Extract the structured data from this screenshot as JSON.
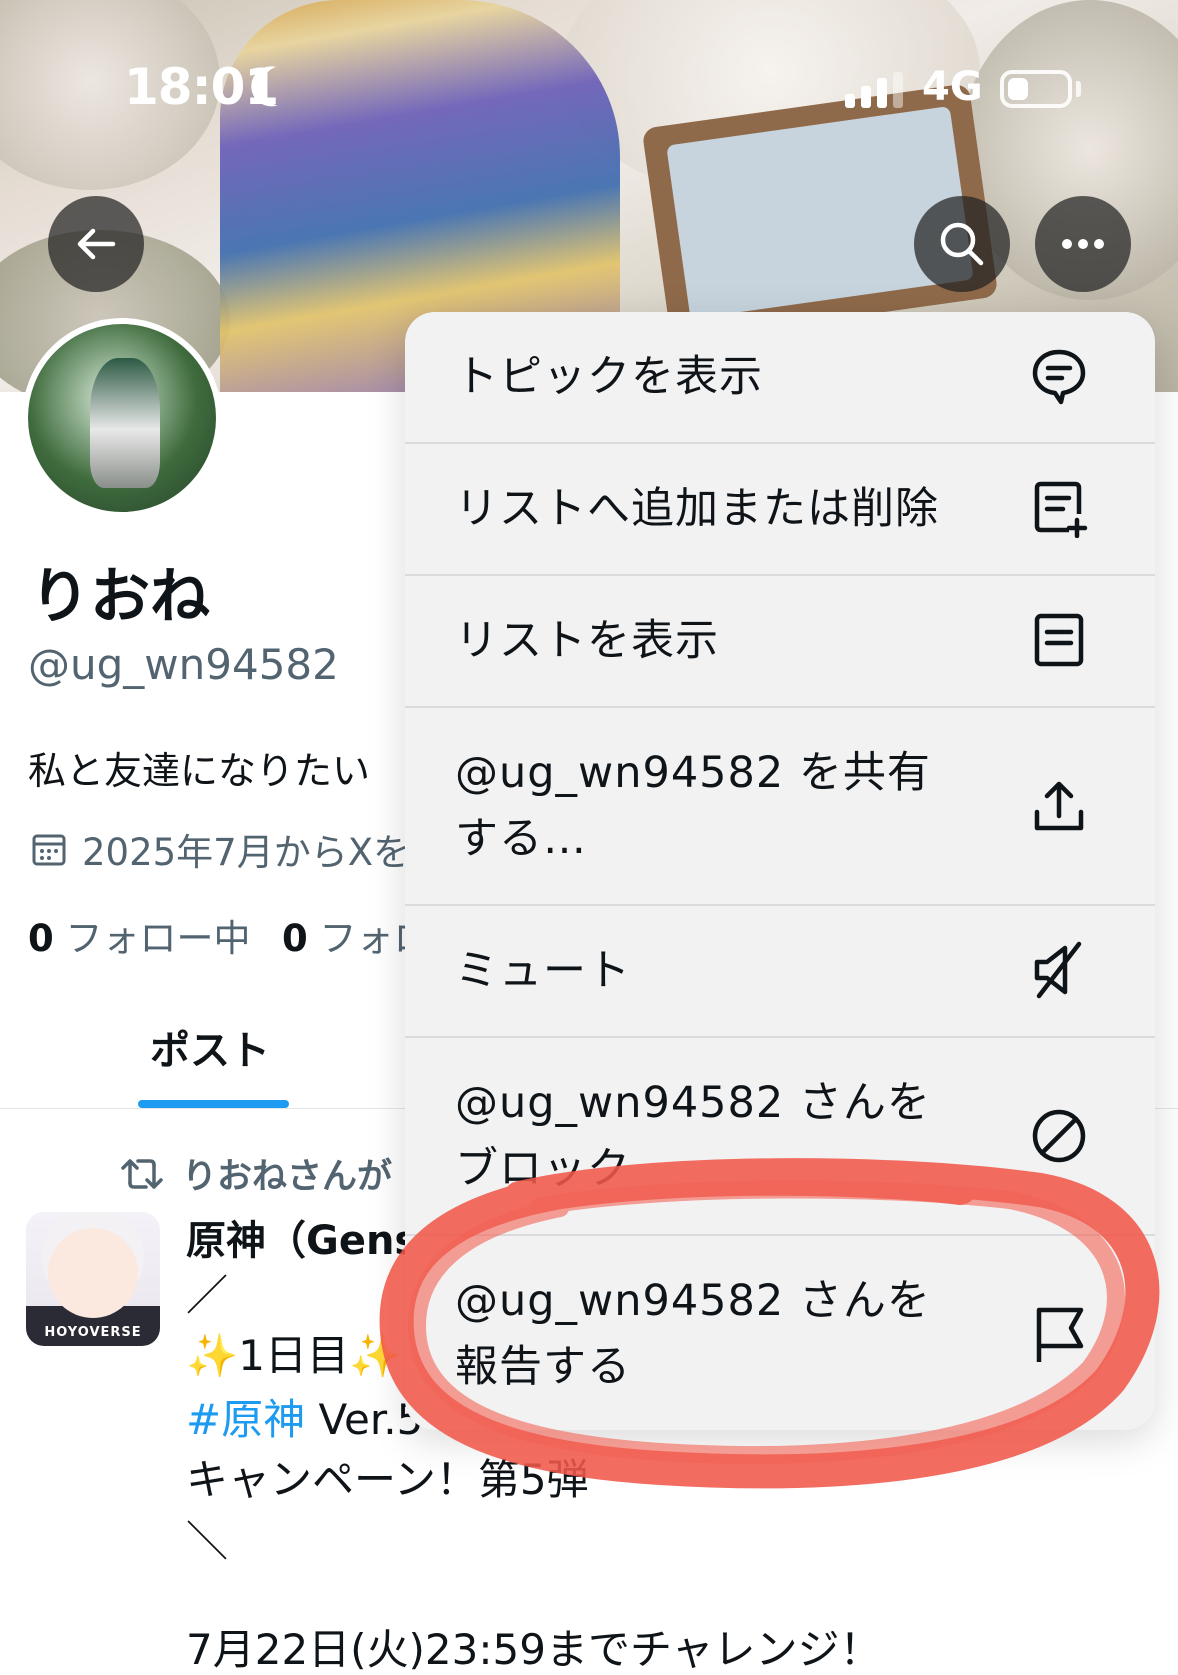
{
  "status_bar": {
    "time": "18:01",
    "network": "4G"
  },
  "header": {
    "back_icon": "arrow-left-icon",
    "search_icon": "search-icon",
    "more_icon": "more-horizontal-icon"
  },
  "profile": {
    "display_name": "りおね",
    "handle": "@ug_wn94582",
    "bio": "私と友達になりたい",
    "joined": "2025年7月からXを",
    "following_count": "0",
    "following_label": "フォロー中",
    "followers_count": "0",
    "followers_label": "フォロ"
  },
  "tabs": {
    "posts": "ポスト"
  },
  "post": {
    "repost_text": "りおねさんが",
    "author": "原神（Gens",
    "avatar_logo": "HOYOVERSE",
    "line_slash": "／",
    "line_day": "✨1日目✨",
    "hashtag": "#原神",
    "line_ver": " Ver.5",
    "line_campaign": "キャンペーン！第5弾",
    "line_backslash": "＼",
    "line_deadline": "7月22日(火)23:59までチャレンジ！"
  },
  "menu": {
    "items": [
      {
        "label": "トピックを表示",
        "icon": "topic-bubble-icon"
      },
      {
        "label": "リストへ追加または削除",
        "icon": "list-add-icon"
      },
      {
        "label": "リストを表示",
        "icon": "list-icon"
      },
      {
        "label_line1": "@ug_wn94582 を共有",
        "label_line2": "する…",
        "icon": "share-icon"
      },
      {
        "label": "ミュート",
        "icon": "mute-icon"
      },
      {
        "label_line1": "@ug_wn94582 さんを",
        "label_line2": "ブロック",
        "icon": "block-icon"
      },
      {
        "label_line1": "@ug_wn94582 さんを",
        "label_line2": "報告する",
        "icon": "flag-icon"
      }
    ]
  },
  "colors": {
    "accent": "#1d9bf0",
    "annotation": "#f0584a",
    "menu_bg": "#f2f2f3",
    "secondary_text": "#536471"
  }
}
